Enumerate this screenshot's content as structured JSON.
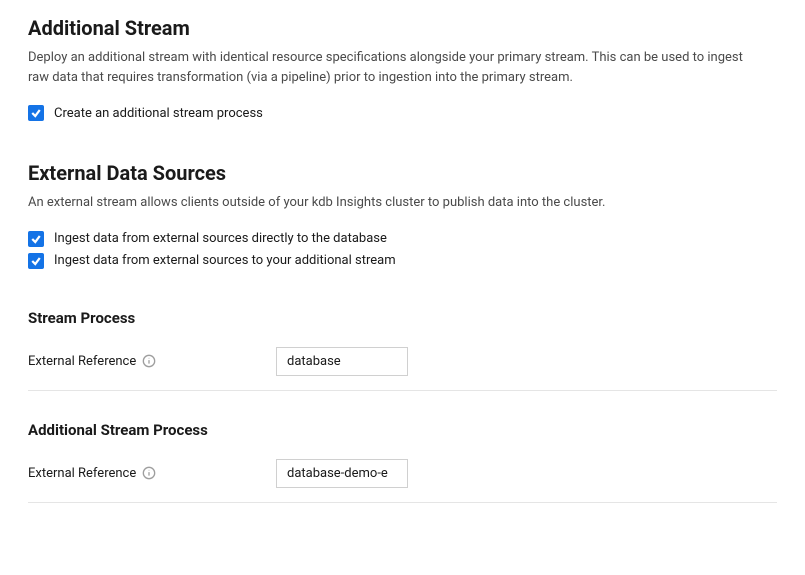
{
  "additionalStream": {
    "title": "Additional Stream",
    "description": "Deploy an additional stream with identical resource specifications alongside your primary stream. This can be used to ingest raw data that requires transformation (via a pipeline) prior to ingestion into the primary stream.",
    "checkbox": {
      "label": "Create an additional stream process",
      "checked": true
    }
  },
  "externalDataSources": {
    "title": "External Data Sources",
    "description": "An external stream allows clients outside of your kdb Insights cluster to publish data into the cluster.",
    "checkboxes": [
      {
        "label": "Ingest data from external sources directly to the database",
        "checked": true
      },
      {
        "label": "Ingest data from external sources to your additional stream",
        "checked": true
      }
    ]
  },
  "streamProcess": {
    "title": "Stream Process",
    "fieldLabel": "External Reference",
    "fieldValue": "database"
  },
  "additionalStreamProcess": {
    "title": "Additional Stream Process",
    "fieldLabel": "External Reference",
    "fieldValue": "database-demo-e"
  }
}
